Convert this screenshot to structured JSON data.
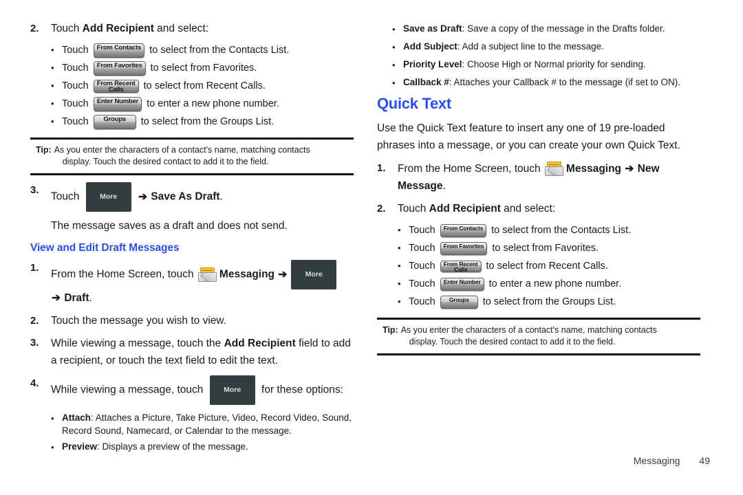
{
  "page": {
    "footer_section": "Messaging",
    "footer_page_number": "49",
    "heading_color": "#2b4ee8"
  },
  "buttons": {
    "from_contacts": "From Contacts",
    "from_favorites": "From Favorites",
    "from_recent_1": "From Recent",
    "from_recent_2": "Calls",
    "enter_number": "Enter Number",
    "groups": "Groups",
    "more": "More"
  },
  "icons": {
    "messaging": "messaging-envelope-icon"
  },
  "left_column": {
    "step2": {
      "number": "2.",
      "text_before": "Touch ",
      "bold": "Add Recipient",
      "text_after": " and select:"
    },
    "recipient_bullets": [
      {
        "pre": "Touch",
        "button": "From Contacts",
        "post": "to select from the Contacts List."
      },
      {
        "pre": "Touch",
        "button": "From Favorites",
        "post": "to select from Favorites."
      },
      {
        "pre": "Touch",
        "button": "From Recent Calls",
        "post": "to select from Recent Calls."
      },
      {
        "pre": "Touch",
        "button": "Enter Number",
        "post": "to enter a new phone number."
      },
      {
        "pre": "Touch",
        "button": "Groups",
        "post": "to select from the Groups List."
      }
    ],
    "tip": {
      "label": "Tip:",
      "line1": "As you enter the characters of a contact's name, matching contacts",
      "line2": "display. Touch the desired contact to add it to the field."
    },
    "step3": {
      "number": "3.",
      "text_before": "Touch ",
      "arrow": "➔",
      "bold": "Save As Draft",
      "text_after": ".",
      "followup": "The message saves as a draft and does not send."
    },
    "subheading": "View and Edit Draft Messages",
    "step_d1": {
      "number": "1.",
      "text_before": "From the Home Screen, touch ",
      "bold_messaging": "Messaging ",
      "arrow1": "➔",
      "arrow2": "➔",
      "bold_draft": "Draft",
      "period": "."
    },
    "step_d2": {
      "number": "2.",
      "text": "Touch the message you wish to view."
    },
    "step_d3": {
      "number": "3.",
      "text_before": "While viewing a message, touch the ",
      "bold": "Add Recipient",
      "text_after": " field to add a recipient, or touch the text field to edit the text."
    },
    "step_d4": {
      "number": "4.",
      "text_before": "While viewing a message, touch ",
      "text_after": " for these options:"
    },
    "option_bullets": [
      {
        "bold": "Attach",
        "rest": ": Attaches a Picture, Take Picture, Video, Record Video, Sound, Record Sound, Namecard, or Calendar to the message."
      },
      {
        "bold": "Preview",
        "rest": ": Displays a preview of the message."
      }
    ]
  },
  "right_column": {
    "option_bullets": [
      {
        "bold": "Save as Draft",
        "rest": ": Save a copy of the message in the Drafts folder."
      },
      {
        "bold": "Add Subject",
        "rest": ": Add a subject line to the message."
      },
      {
        "bold": "Priority Level",
        "rest": ": Choose High or Normal priority for sending."
      },
      {
        "bold": "Callback #",
        "rest": ": Attaches your Callback # to the message (if set to ON)."
      }
    ],
    "heading": "Quick Text",
    "intro": "Use the Quick Text feature to insert any one of 19 pre-loaded phrases into a message, or you can create your own Quick Text.",
    "step1": {
      "number": "1.",
      "text_before": "From the Home Screen, touch ",
      "bold_messaging": "Messaging ",
      "arrow": "➔",
      "bold_new": " New Message",
      "period": "."
    },
    "step2": {
      "number": "2.",
      "text_before": "Touch ",
      "bold": "Add Recipient",
      "text_after": " and select:"
    },
    "recipient_bullets": [
      {
        "pre": "Touch",
        "button": "From Contacts",
        "post": "to select from the Contacts List."
      },
      {
        "pre": "Touch",
        "button": "From Favorites",
        "post": "to select from Favorites."
      },
      {
        "pre": "Touch",
        "button": "From Recent Calls",
        "post": "to select from Recent Calls."
      },
      {
        "pre": "Touch",
        "button": "Enter Number",
        "post": "to enter a new phone number."
      },
      {
        "pre": "Touch",
        "button": "Groups",
        "post": "to select from the Groups List."
      }
    ],
    "tip": {
      "label": "Tip:",
      "line1": "As you enter the characters of a contact's name, matching contacts",
      "line2": "display. Touch the desired contact to add it to the field."
    }
  }
}
